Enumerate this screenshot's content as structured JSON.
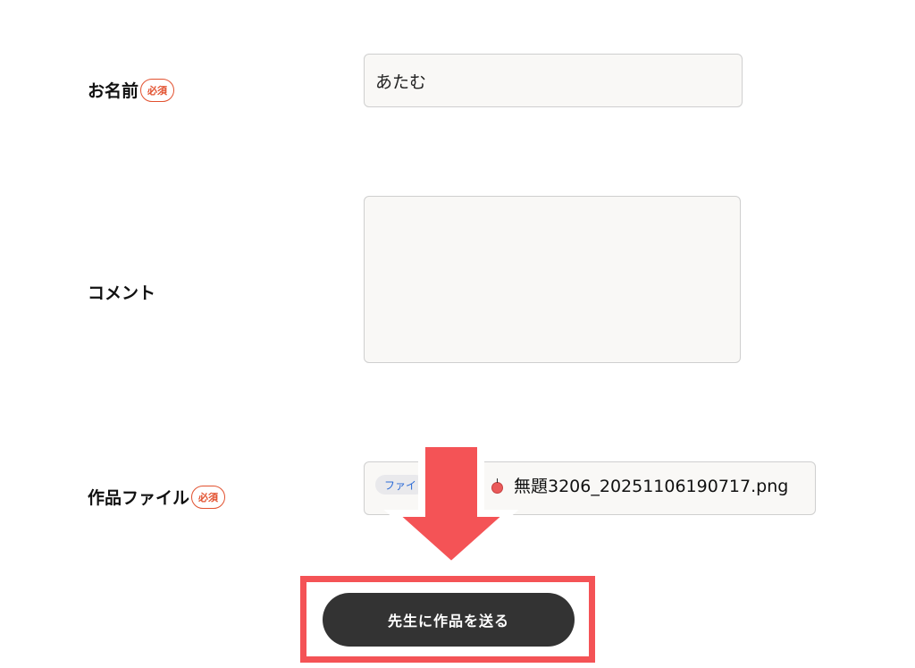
{
  "form": {
    "name": {
      "label": "お名前",
      "required_badge": "必須",
      "value": "あたむ"
    },
    "comment": {
      "label": "コメント",
      "value": ""
    },
    "artwork_file": {
      "label": "作品ファイル",
      "required_badge": "必須",
      "choose_button": "ファイ",
      "file_name": "無題3206_20251106190717.png"
    },
    "submit": {
      "label": "先生に作品を送る"
    }
  },
  "annotation": {
    "arrow_color": "#f45356",
    "frame_color": "#f45356"
  },
  "colors": {
    "required_badge": "#e2512f",
    "submit_button_bg": "#333333",
    "input_bg": "#f9f8f6"
  }
}
